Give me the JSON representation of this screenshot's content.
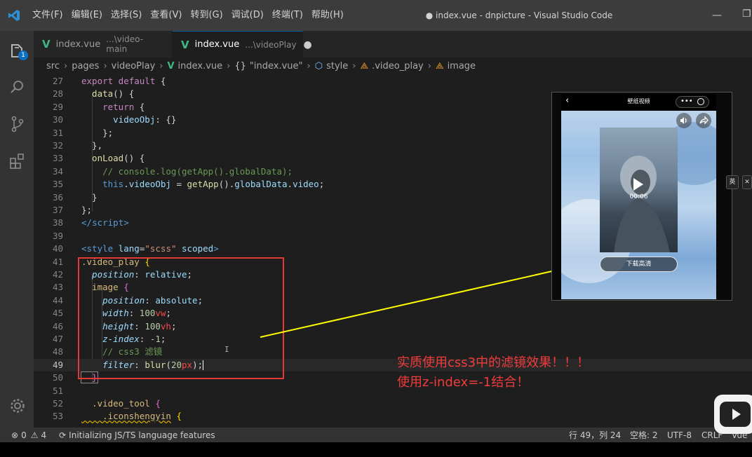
{
  "menu": [
    "文件(F)",
    "编辑(E)",
    "选择(S)",
    "查看(V)",
    "转到(G)",
    "调试(D)",
    "终端(T)",
    "帮助(H)"
  ],
  "window_title": "● index.vue - dnpicture - Visual Studio Code",
  "activity": {
    "badge": "1"
  },
  "tabs": [
    {
      "name": "index.vue",
      "path": "...\\video-main"
    },
    {
      "name": "index.vue",
      "path": "...\\videoPlay",
      "dirty": "●"
    }
  ],
  "breadcrumb": {
    "src": "src",
    "pages": "pages",
    "videoPlay": "videoPlay",
    "file": "index.vue",
    "obj": "\"index.vue\"",
    "style": "style",
    "cls": ".video_play",
    "image": "image"
  },
  "line_numbers": [
    "27",
    "28",
    "29",
    "30",
    "31",
    "32",
    "33",
    "34",
    "35",
    "36",
    "37",
    "38",
    "39",
    "40",
    "41",
    "42",
    "43",
    "44",
    "45",
    "46",
    "47",
    "48",
    "49",
    "50",
    "51",
    "52",
    "53"
  ],
  "code": {
    "l27a": "export",
    "l27b": " default",
    "l27c": " {",
    "l28a": "  data",
    "l28b": "() {",
    "l29a": "    return",
    "l29b": " {",
    "l30a": "      videoObj",
    "l30b": ": {}",
    "l31": "    };",
    "l32": "  },",
    "l33a": "  onLoad",
    "l33b": "() {",
    "l34": "    // console.log(getApp().globalData);",
    "l35a": "    this",
    "l35b": ".videoObj",
    "l35c": " = ",
    "l35d": "getApp",
    "l35e": "().",
    "l35f": "globalData",
    "l35g": ".",
    "l35h": "video",
    "l35i": ";",
    "l36": "  }",
    "l37": "};",
    "l38a": "</",
    "l38b": "script",
    "l38c": ">",
    "l40a": "<",
    "l40b": "style",
    "l40c": " lang",
    "l40d": "=",
    "l40e": "\"scss\"",
    "l40f": " scoped",
    "l40g": ">",
    "l41a": ".video_play",
    "l41b": " {",
    "l42a": "  position",
    "l42b": ": ",
    "l42c": "relative",
    "l42d": ";",
    "l43a": "  image",
    "l43b": " {",
    "l44a": "    position",
    "l44b": ": ",
    "l44c": "absolute",
    "l44d": ";",
    "l45a": "    width",
    "l45b": ": ",
    "l45c": "100",
    "l45d": "vw",
    "l45e": ";",
    "l46a": "    height",
    "l46b": ": ",
    "l46c": "100",
    "l46d": "vh",
    "l46e": ";",
    "l47a": "    z-index",
    "l47b": ": ",
    "l47c": "-1",
    "l47d": ";",
    "l48": "    // css3 滤镜",
    "l49a": "    filter",
    "l49b": ": ",
    "l49c": "blur",
    "l49d": "(",
    "l49e": "20",
    "l49f": "px",
    "l49g": ");",
    "l50": "  }",
    "l52a": "  .video_tool",
    "l52b": " {",
    "l53a": "    .iconshengyin",
    "l53b": " {"
  },
  "annotation": {
    "line1": "实质使用css3中的滤镜效果！！！",
    "line2": "使用z-index=-1结合！",
    "color": "#f03c3c"
  },
  "preview": {
    "nav_title": "壁纸视频",
    "video_time": "00:06",
    "download_label": "下载高清"
  },
  "side_chip": "英",
  "status": {
    "errors": "0",
    "warnings": "4",
    "task": "Initializing JS/TS language features",
    "position": "行 49，列 24",
    "spaces": "空格: 2",
    "encoding": "UTF-8",
    "eol": "CRLF",
    "language": "Vue"
  }
}
